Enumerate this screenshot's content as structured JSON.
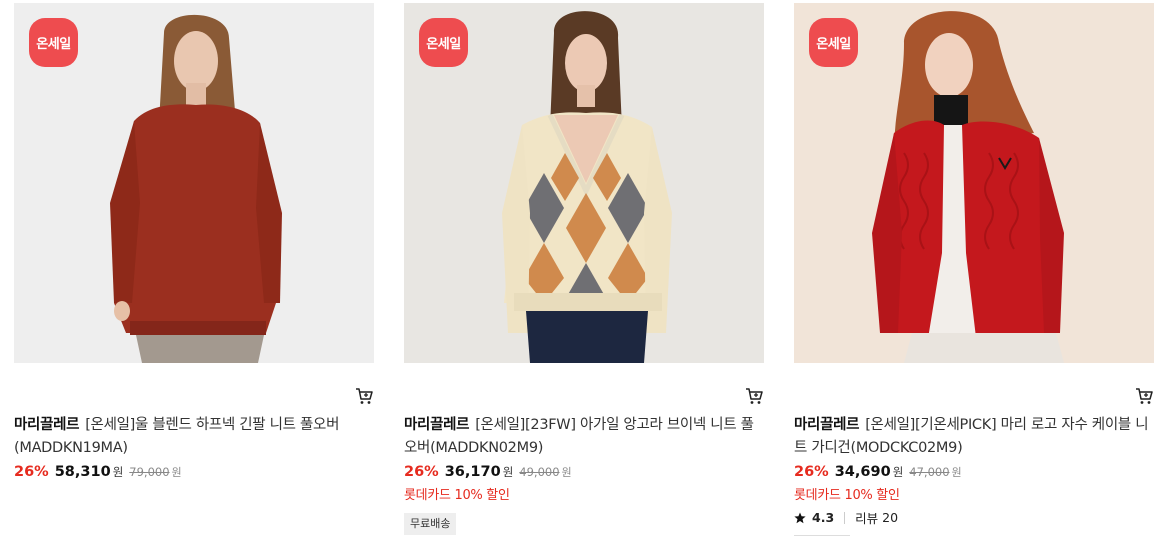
{
  "products": [
    {
      "badge": "온세일",
      "brand": "마리끌레르",
      "name": "[온세일]울 블렌드 하프넥 긴팔 니트 풀오버(MADDKN19MA)",
      "discount": "26%",
      "price": "58,310",
      "currency": "원",
      "original_price": "79,000",
      "original_currency": "원",
      "image_colors": {
        "bg": "#eeeeee",
        "garment": "#9b2f1f",
        "pants": "#a3998f",
        "hair": "#8a5a36"
      }
    },
    {
      "badge": "온세일",
      "brand": "마리끌레르",
      "name": "[온세일][23FW] 아가일 앙고라 브이넥 니트 풀오버(MADDKN02M9)",
      "discount": "26%",
      "price": "36,170",
      "currency": "원",
      "original_price": "49,000",
      "original_currency": "원",
      "promo": "롯데카드 10% 할인",
      "shipping_tag": "무료배송",
      "image_colors": {
        "bg": "#e8e6e2",
        "garment": "#f1e5c6",
        "argyle_a": "#6f6f73",
        "argyle_b": "#d08a4d",
        "pants": "#1d2740",
        "hair": "#5a3a25"
      }
    },
    {
      "badge": "온세일",
      "brand": "마리끌레르",
      "name": "[온세일][기온세PICK] 마리 로고 자수 케이블 니트 가디건(MODCKC02M9)",
      "discount": "26%",
      "price": "34,690",
      "currency": "원",
      "original_price": "47,000",
      "original_currency": "원",
      "promo": "롯데카드 10% 할인",
      "rating": "4.3",
      "review_label": "리뷰",
      "review_count": "20",
      "image_colors": {
        "bg": "#f1e4d8",
        "garment": "#c4181d",
        "dress": "#f2eeea",
        "turtleneck": "#151515",
        "hair": "#a8552d"
      }
    }
  ]
}
